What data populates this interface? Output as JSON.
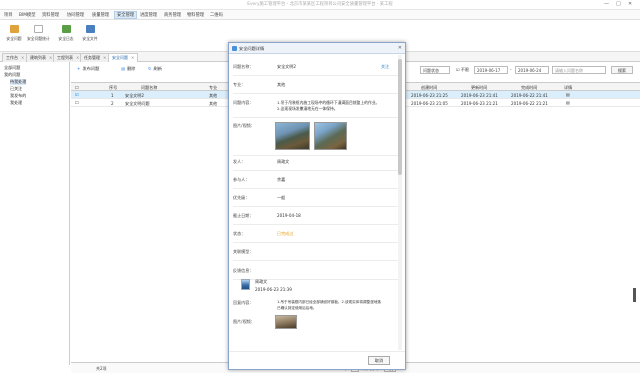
{
  "window": {
    "title": "Every施工管理平台 - 北京市某某区工程项目公司安全质量管理平台 - 某工程",
    "min": "—",
    "max": "□",
    "close": "✕"
  },
  "menu": [
    "项目",
    "BIM模型",
    "资料管理",
    "协同管理",
    "质量管理",
    "安全管理",
    "进度管理",
    "商务管理",
    "物料管理",
    "二维码"
  ],
  "ribbon": [
    {
      "label": "安全问题",
      "color": "#e0a23a"
    },
    {
      "label": "安全问题统计",
      "color": "#b0b0b0"
    },
    {
      "label": "安全日志",
      "color": "#5a9e45"
    },
    {
      "label": "安全文件",
      "color": "#4a7fc0"
    }
  ],
  "tabs": [
    "工作台",
    "建筑列表",
    "工程列表",
    "任务管理",
    "安全问题"
  ],
  "sidebar": {
    "root": "全部问题",
    "items": [
      "我的问题",
      "待我处理",
      "已关注",
      "我发布的",
      "我处理"
    ]
  },
  "toolbar": {
    "add": "发布问题",
    "delete": "删除",
    "refresh": "刷新"
  },
  "filters": {
    "status": "问题状态",
    "date_label": "不限",
    "date_from": "2019-06-17",
    "date_to": "2019-06-24",
    "search_placeholder": "请输入问题名称",
    "search_btn": "搜索"
  },
  "grid": {
    "headers": [
      "序号",
      "问题名称",
      "专业",
      "创建时间",
      "更新时间",
      "完成时间",
      "详情"
    ],
    "rows": [
      {
        "no": "1",
        "name": "安全文明2",
        "major": "其他",
        "created": "2019-06-23 21:25",
        "updated": "2019-06-23 21:41",
        "done": "2019-06-22 21:41"
      },
      {
        "no": "2",
        "name": "安全文明问题",
        "major": "其他",
        "created": "2019-06-23 21:05",
        "updated": "2019-06-23 21:21",
        "done": "2019-06-22 21:21"
      }
    ]
  },
  "status": {
    "total": "共2项",
    "page": "1",
    "pages": "/ 共1页",
    "per": "1页"
  },
  "dialog": {
    "title": "安全问题详情",
    "close": "✕",
    "fields": {
      "name_label": "问题名称：",
      "name": "安全文明2",
      "follow": "关注",
      "major_label": "专业：",
      "major": "其他",
      "content_label": "问题内容：",
      "content1": "1.吊于吊装框内施工现场中的循环下漫满面目前整上的作业。",
      "content2": "2.这现现场发撒漫地无在一体保持。",
      "photo_label": "图片/视频：",
      "creator_label": "发人：",
      "creator": "周政文",
      "participant_label": "参与人：",
      "participant": "余嘉",
      "level_label": "优先级：",
      "level": "一般",
      "deadline_label": "截止日期：",
      "deadline": "2019-04-18",
      "status_label": "状态：",
      "status": "已完成过",
      "related_label": "关联模型：",
      "feedback_label": "反馈信息："
    },
    "feedback": {
      "user": "周政文",
      "time": "2019-06-23 21:39",
      "content_label": "回复内容：",
      "content1": "1.吊于吊装框内部已经全部铺设好钢板。2.该现实体将调整漫地落",
      "content2": "已确认到定使用后后地。",
      "photo_label": "图片/视频："
    },
    "cancel": "取消"
  },
  "colors": {
    "accent": "#2b7de0",
    "status_done": "#e0a020",
    "follow": "#3a8fd0"
  }
}
